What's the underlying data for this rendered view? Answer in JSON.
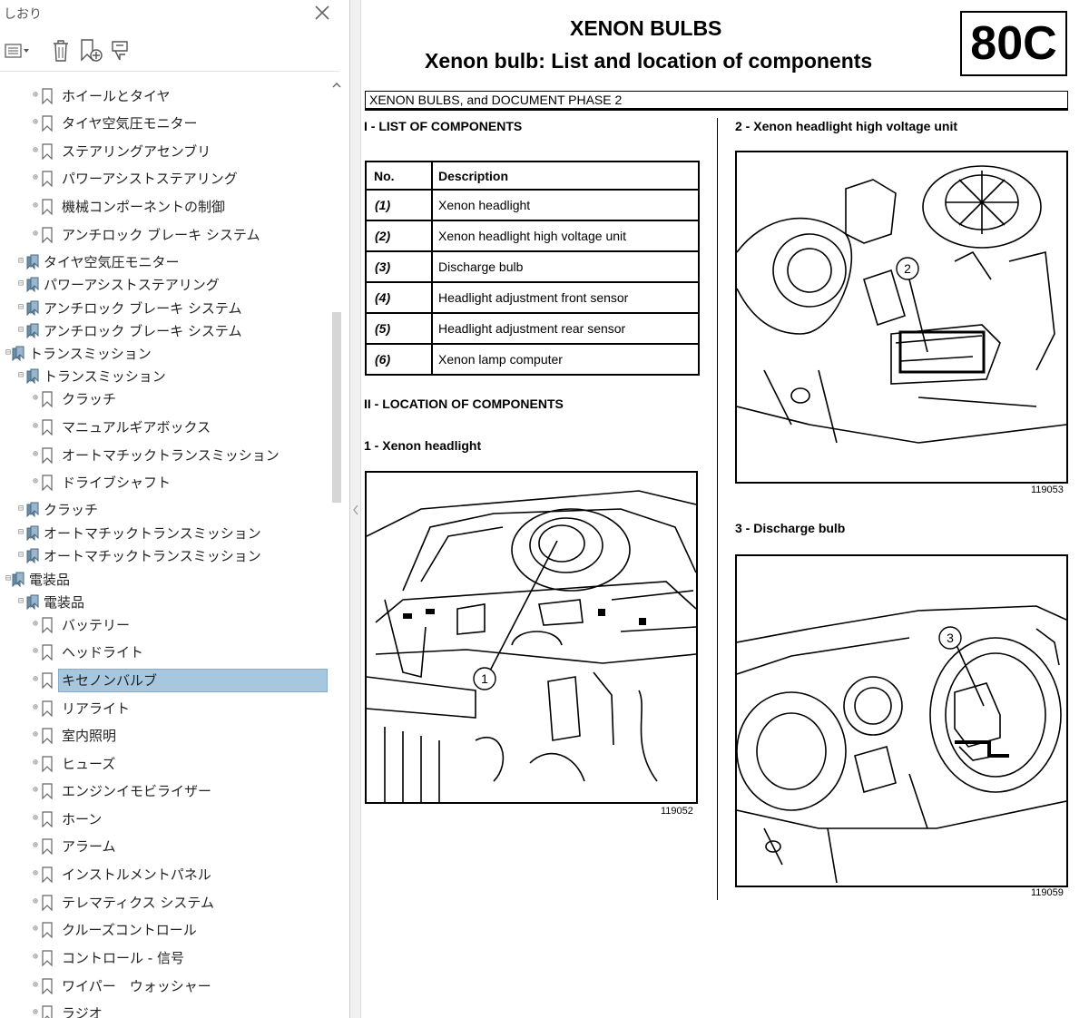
{
  "panel": {
    "title": "しおり",
    "items": [
      {
        "label": "ホイールとタイヤ",
        "level": 2
      },
      {
        "label": "タイヤ空気圧モニター",
        "level": 2
      },
      {
        "label": "ステアリングアセンブリ",
        "level": 2
      },
      {
        "label": "パワーアシストステアリング",
        "level": 2
      },
      {
        "label": "機械コンポーネントの制御",
        "level": 2
      },
      {
        "label": "アンチロック ブレーキ システム",
        "level": 2
      },
      {
        "label": "タイヤ空気圧モニター",
        "level": 1
      },
      {
        "label": "パワーアシストステアリング",
        "level": 1
      },
      {
        "label": "アンチロック ブレーキ システム",
        "level": 1
      },
      {
        "label": "アンチロック ブレーキ システム",
        "level": 1
      },
      {
        "label": "トランスミッション",
        "level": 0
      },
      {
        "label": "トランスミッション",
        "level": 1
      },
      {
        "label": "クラッチ",
        "level": 2
      },
      {
        "label": "マニュアルギアボックス",
        "level": 2
      },
      {
        "label": "オートマチックトランスミッション",
        "level": 2
      },
      {
        "label": "ドライブシャフト",
        "level": 2
      },
      {
        "label": "クラッチ",
        "level": 1
      },
      {
        "label": "オートマチックトランスミッション",
        "level": 1
      },
      {
        "label": "オートマチックトランスミッション",
        "level": 1
      },
      {
        "label": "電装品",
        "level": 0
      },
      {
        "label": "電装品",
        "level": 1
      },
      {
        "label": "バッテリー",
        "level": 2
      },
      {
        "label": "ヘッドライト",
        "level": 2
      },
      {
        "label": "キセノンバルブ",
        "level": 2,
        "selected": true
      },
      {
        "label": "リアライト",
        "level": 2
      },
      {
        "label": "室内照明",
        "level": 2
      },
      {
        "label": "ヒューズ",
        "level": 2
      },
      {
        "label": "エンジンイモビライザー",
        "level": 2
      },
      {
        "label": "ホーン",
        "level": 2
      },
      {
        "label": "アラーム",
        "level": 2
      },
      {
        "label": "インストルメントパネル",
        "level": 2
      },
      {
        "label": "テレマティクス システム",
        "level": 2
      },
      {
        "label": "クルーズコントロール",
        "level": 2
      },
      {
        "label": "コントロール - 信号",
        "level": 2
      },
      {
        "label": "ワイパー　ウォッシャー",
        "level": 2
      },
      {
        "label": "ラジオ",
        "level": 2
      }
    ]
  },
  "doc": {
    "title": "XENON BULBS",
    "subtitle": "Xenon bulb: List and location of components",
    "code": "80C",
    "phase": "XENON BULBS, and DOCUMENT PHASE 2",
    "list_heading": "I - LIST OF COMPONENTS",
    "table_headers": [
      "No.",
      "Description"
    ],
    "table_rows": [
      [
        "(1)",
        "Xenon headlight"
      ],
      [
        "(2)",
        "Xenon headlight high voltage unit"
      ],
      [
        "(3)",
        "Discharge bulb"
      ],
      [
        "(4)",
        "Headlight adjustment front sensor"
      ],
      [
        "(5)",
        "Headlight adjustment rear sensor"
      ],
      [
        "(6)",
        "Xenon lamp computer"
      ]
    ],
    "location_heading": "II - LOCATION OF COMPONENTS",
    "fig1": {
      "caption": "1 - Xenon headlight",
      "ref": "119052",
      "callout": "1"
    },
    "fig2": {
      "caption": "2 - Xenon headlight high voltage unit",
      "ref": "119053",
      "callout": "2"
    },
    "fig3": {
      "caption": "3 - Discharge bulb",
      "ref": "119059",
      "callout": "3"
    }
  }
}
